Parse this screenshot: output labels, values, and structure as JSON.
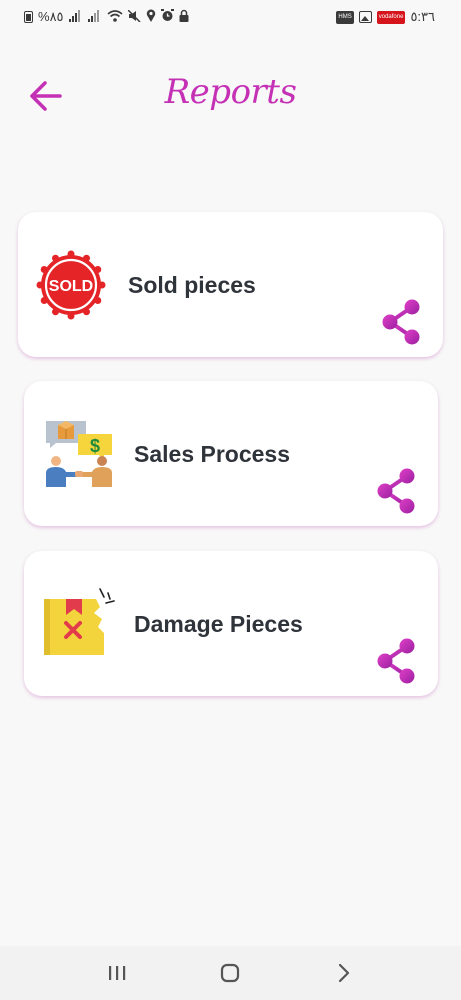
{
  "status_bar": {
    "battery_text": "%٨٥",
    "time": "٥:٣٦",
    "left_icons": [
      "battery-icon",
      "signal-icon",
      "signal-icon",
      "wifi-icon",
      "mute-icon",
      "location-icon",
      "alarm-icon",
      "lock-icon"
    ],
    "right_icons": [
      "hms-icon",
      "gallery-icon",
      "vodafone-icon"
    ],
    "hms_label": "HMS",
    "carrier_label": "vodafone"
  },
  "header": {
    "title": "Reports",
    "back_icon": "arrow-left-icon"
  },
  "reports": [
    {
      "label": "Sold pieces",
      "icon": "sold-badge-icon",
      "icon_text": "SOLD",
      "action_icon": "share-icon"
    },
    {
      "label": "Sales Process",
      "icon": "sales-handshake-icon",
      "icon_text": "$",
      "action_icon": "share-icon"
    },
    {
      "label": "Damage Pieces",
      "icon": "damaged-box-icon",
      "action_icon": "share-icon"
    }
  ],
  "colors": {
    "accent": "#c531b5",
    "background": "#f8f8f8",
    "card": "#ffffff",
    "text": "#2f333a",
    "sold_red": "#e52428",
    "share_gradient_start": "#e040c8",
    "share_gradient_end": "#9b1fa0"
  },
  "nav_bar": {
    "buttons": [
      "recent-apps-icon",
      "home-icon",
      "back-chevron-icon"
    ]
  }
}
